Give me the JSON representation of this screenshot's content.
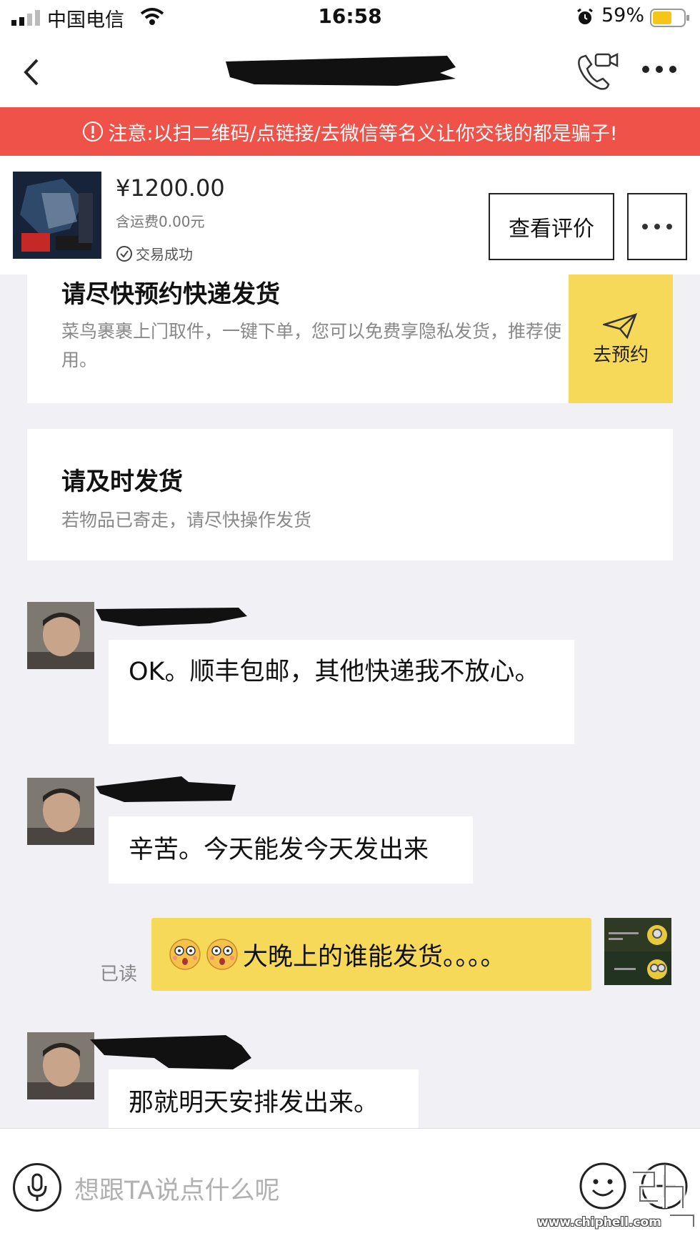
{
  "status_bar": {
    "carrier": "中国电信",
    "time": "16:58",
    "battery": "59%"
  },
  "warning": {
    "text": "注意:以扫二维码/点链接/去微信等名义让你交钱的都是骗子!"
  },
  "product": {
    "price": "¥1200.00",
    "shipping": "含运费0.00元",
    "status": "交易成功",
    "review_button": "查看评价"
  },
  "cards": {
    "reserve": {
      "title": "请尽快预约快递发货",
      "desc": "菜鸟裹裹上门取件，一键下单，您可以免费享隐私发货，推荐使用。",
      "button": "去预约"
    },
    "ship": {
      "title": "请及时发货",
      "desc": "若物品已寄走，请尽快操作发货"
    }
  },
  "messages": [
    {
      "from": "other",
      "text": "OK。顺丰包邮，其他快递我不放心。"
    },
    {
      "from": "other",
      "text": "辛苦。今天能发今天发出来"
    },
    {
      "from": "me",
      "text": "大晚上的谁能发货。。。。",
      "read": "已读"
    },
    {
      "from": "other",
      "text": "那就明天安排发出来。"
    }
  ],
  "input": {
    "placeholder": "想跟TA说点什么呢"
  },
  "watermark": {
    "url": "www.chiphell.com"
  },
  "colors": {
    "warning_bg": "#ee5249",
    "accent_yellow": "#f7d95a",
    "page_bg": "#f1f1f5"
  }
}
